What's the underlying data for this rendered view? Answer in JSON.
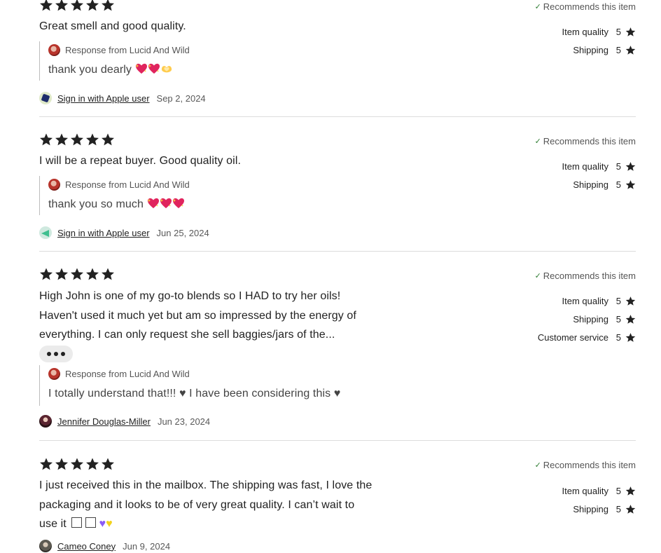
{
  "reviews": [
    {
      "text": "Great smell and good quality.",
      "stars": 5,
      "recommends": "Recommends this item",
      "ratings": [
        {
          "label": "Item quality",
          "value": "5"
        },
        {
          "label": "Shipping",
          "value": "5"
        }
      ],
      "response": {
        "from": "Response from Lucid And Wild",
        "text": "thank you dearly",
        "emojis": [
          "sparkling-heart",
          "sparkling-heart",
          "heart-hands"
        ]
      },
      "reviewer": {
        "name": "Sign in with Apple user",
        "date": "Sep 2, 2024",
        "avatar": "blue-shape-avatar"
      }
    },
    {
      "text": "I will be a repeat buyer. Good quality oil.",
      "stars": 5,
      "recommends": "Recommends this item",
      "ratings": [
        {
          "label": "Item quality",
          "value": "5"
        },
        {
          "label": "Shipping",
          "value": "5"
        }
      ],
      "response": {
        "from": "Response from Lucid And Wild",
        "text": "thank you so much",
        "emojis": [
          "sparkling-heart",
          "sparkling-heart",
          "sparkling-heart"
        ]
      },
      "reviewer": {
        "name": "Sign in with Apple user",
        "date": "Jun 25, 2024",
        "avatar": "green-shape-avatar"
      }
    },
    {
      "text_lines": [
        "High John is one of my go-to blends so I HAD to try her oils!",
        "Haven't used it much yet but am so impressed by the energy of",
        "everything. I can only request she sell baggies/jars of the..."
      ],
      "stars": 5,
      "recommends": "Recommends this item",
      "ratings": [
        {
          "label": "Item quality",
          "value": "5"
        },
        {
          "label": "Shipping",
          "value": "5"
        },
        {
          "label": "Customer service",
          "value": "5"
        }
      ],
      "response": {
        "from": "Response from Lucid And Wild",
        "text": "I totally understand that!!! ♥ I have been considering this ♥"
      },
      "reviewer": {
        "name": "Jennifer Douglas-Miller",
        "date": "Jun 23, 2024",
        "avatar": "photo-avatar"
      }
    },
    {
      "text_lines": [
        "I just received this in the mailbox. The shipping was fast, I love the",
        "packaging and it looks to be of very great quality. I can’t wait to",
        "use it"
      ],
      "stars": 5,
      "recommends": "Recommends this item",
      "ratings": [
        {
          "label": "Item quality",
          "value": "5"
        },
        {
          "label": "Shipping",
          "value": "5"
        }
      ],
      "reviewer": {
        "name": "Cameo Coney",
        "date": "Jun 9, 2024",
        "avatar": "photo-avatar"
      }
    }
  ],
  "colors": {
    "star": "#222222",
    "check": "#2e7d32",
    "divider": "#dcdcdc"
  }
}
